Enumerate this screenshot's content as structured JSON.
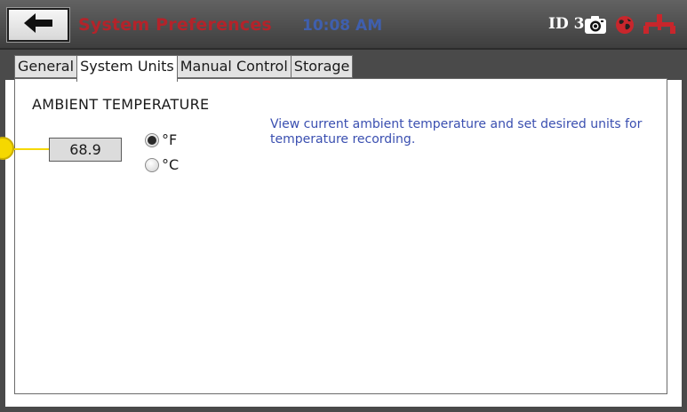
{
  "header": {
    "title": "System Preferences",
    "time": "10:08 AM",
    "device_id": "ID 3",
    "icons": [
      "back-arrow-icon",
      "camera-icon",
      "globe-icon",
      "network-icon"
    ]
  },
  "tabs": [
    {
      "label": "General",
      "active": false
    },
    {
      "label": "System Units",
      "active": true
    },
    {
      "label": "Manual Control",
      "active": false
    },
    {
      "label": "Storage",
      "active": false
    }
  ],
  "ambient": {
    "title": "AMBIENT TEMPERATURE",
    "value": "68.9",
    "unit_options": [
      {
        "label": "°F",
        "selected": true
      },
      {
        "label": "°C",
        "selected": false
      }
    ],
    "description": "View current ambient temperature and set desired units for temperature recording."
  },
  "colors": {
    "title_red": "#b4232a",
    "time_blue": "#3f5fae",
    "description_blue": "#3a4fb0",
    "callout_yellow": "#f5d800",
    "header_gray": "#4a4a4a"
  }
}
